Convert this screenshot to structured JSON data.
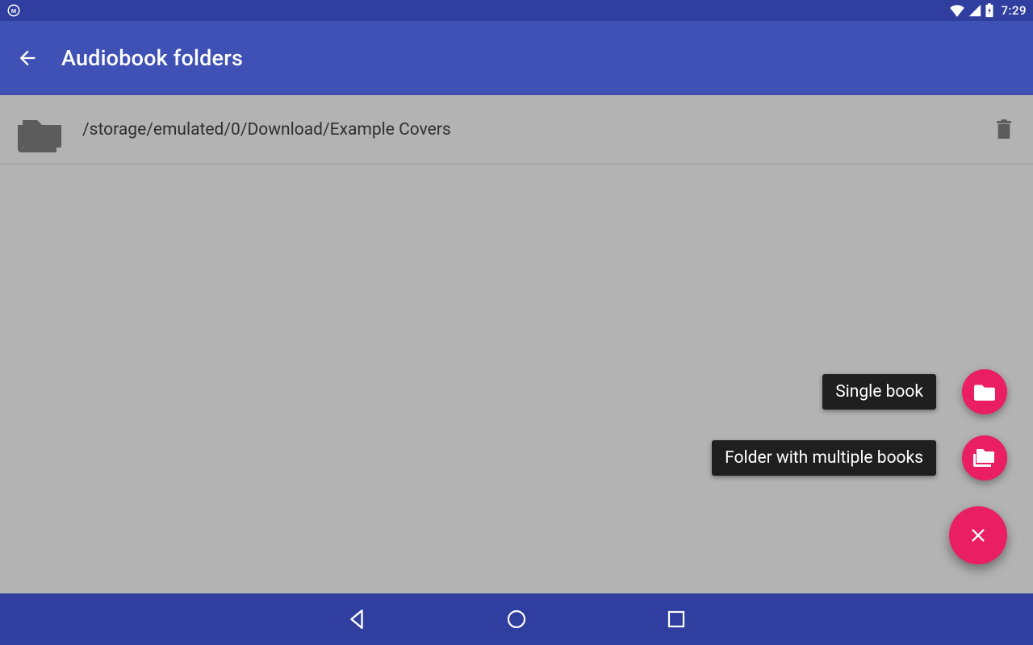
{
  "status": {
    "clock": "7:29"
  },
  "appbar": {
    "title": "Audiobook folders"
  },
  "folders": [
    {
      "path": "/storage/emulated/0/Download/Example Covers"
    }
  ],
  "fab": {
    "single_label": "Single book",
    "multi_label": "Folder with multiple books"
  },
  "colors": {
    "primary": "#3f51b5",
    "primary_dark": "#303f9f",
    "accent": "#e91e63",
    "surface_dim": "#b3b3b3"
  }
}
